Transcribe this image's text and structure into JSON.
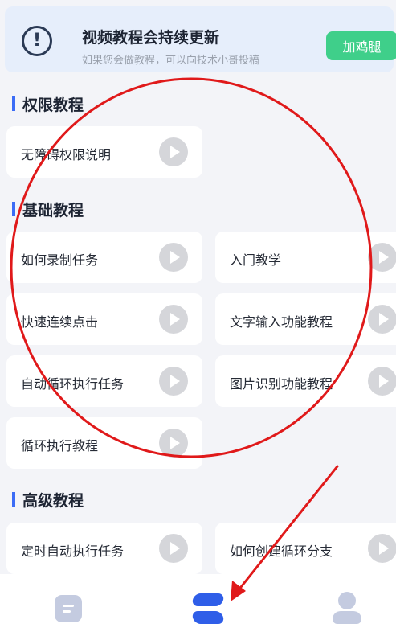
{
  "banner": {
    "icon": "alert-circle-icon",
    "title": "视频教程会持续更新",
    "subtitle": "如果您会做教程，可以向技术小哥投稿",
    "cta_label": "加鸡腿",
    "cta_color": "#3fcf8a"
  },
  "sections": [
    {
      "heading": "权限教程",
      "cards": [
        "无障碍权限说明"
      ]
    },
    {
      "heading": "基础教程",
      "cards": [
        "如何录制任务",
        "入门教学",
        "快速连续点击",
        "文字输入功能教程",
        "自动循环执行任务",
        "图片识别功能教程",
        "循环执行教程"
      ]
    },
    {
      "heading": "高级教程",
      "cards": [
        "定时自动执行任务",
        "如何创建循环分支"
      ]
    }
  ],
  "bottom_nav": {
    "items": [
      "doc-icon",
      "tutorial-icon",
      "profile-icon"
    ],
    "active_color": "#2f5ee8",
    "inactive_color": "#c4cbe0"
  },
  "accent_color": "#3b6cf6",
  "annotation_color": "#e0191a"
}
